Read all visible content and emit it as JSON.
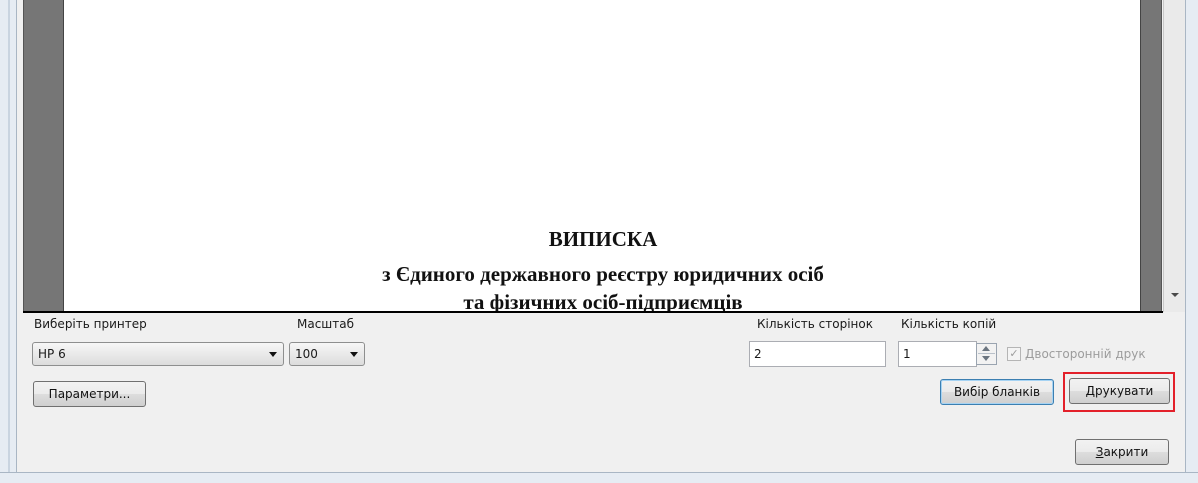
{
  "preview": {
    "doc_title": "ВИПИСКА",
    "doc_line1": "з Єдиного державного реєстру юридичних осіб",
    "doc_line2": "та фізичних осіб-підприємців"
  },
  "printer": {
    "label": "Виберіть принтер",
    "selected": "HP  6"
  },
  "scale": {
    "label": "Масштаб",
    "selected": "100"
  },
  "pages": {
    "label": "Кількість сторінок",
    "value": "2"
  },
  "copies": {
    "label": "Кількість копій",
    "value": "1"
  },
  "duplex": {
    "label": "Двосторонній друк",
    "checked": true,
    "enabled": false
  },
  "buttons": {
    "params": "Параметри...",
    "forms": "Вибір бланків",
    "print": "Друкувати",
    "close_underlined": "З",
    "close_rest": "акрити"
  },
  "colors": {
    "highlight": "#e3202a",
    "preview_bg": "#767676"
  }
}
